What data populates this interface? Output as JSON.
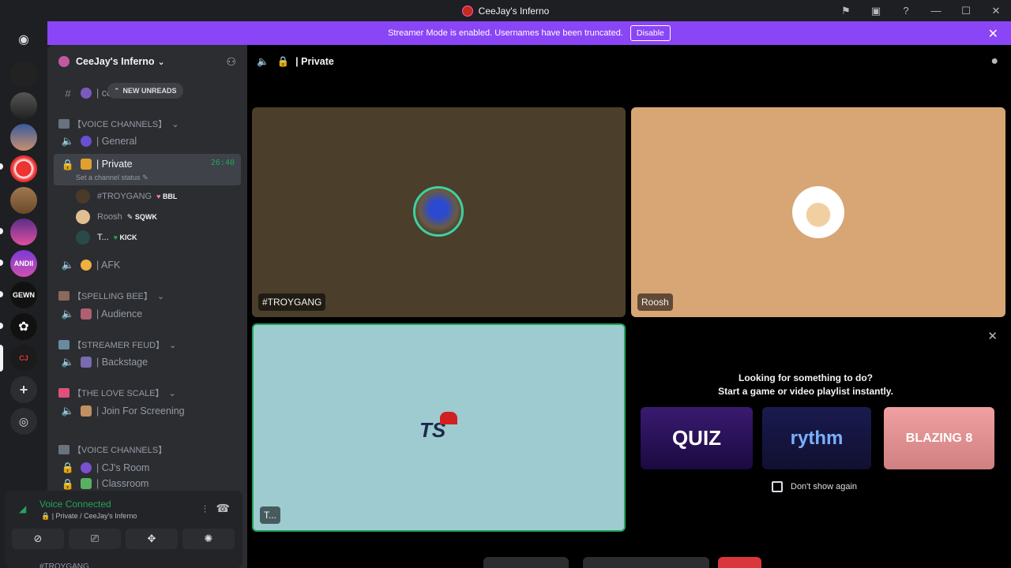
{
  "window": {
    "title": "CeeJay's Inferno",
    "minimize": "—",
    "maximize": "☐",
    "close": "✕"
  },
  "banner": {
    "text": "Streamer Mode is enabled. Usernames have been truncated.",
    "button": "Disable",
    "close": "✕"
  },
  "guild": {
    "name": "CeeJay's Inferno",
    "chevron": "⌄"
  },
  "unread_pill": "NEW UNREADS",
  "sidebar": {
    "top_channel": "| co",
    "cat_voice": "【VOICE CHANNELS】",
    "general": "| General",
    "private": "| Private",
    "private_timer": "26:40",
    "status_hint": "Set a channel status",
    "users": [
      {
        "name": "#TROYGANG",
        "badge": "BBL"
      },
      {
        "name": "Roosh",
        "badge": "SQWK"
      },
      {
        "name": "T...",
        "badge": "KICK"
      }
    ],
    "afk": "| AFK",
    "cat_spelling": "【SPELLING BEE】",
    "audience": "| Audience",
    "cat_feud": "【STREAMER FEUD】",
    "backstage": "| Backstage",
    "cat_love": "【THE LOVE SCALE】",
    "join_screening": "| Join For Screening",
    "cat_voice2": "【VOICE CHANNELS】",
    "cj_room": "| CJ's Room",
    "classroom": "| Classroom"
  },
  "voice_panel": {
    "title": "Voice Connected",
    "subtitle": "| Private / CeeJay's Inferno",
    "user_peek": "#TROYGANG"
  },
  "main": {
    "channel_title": "| Private",
    "tiles": [
      {
        "name": "#TROYGANG",
        "bg": "#4b3e2a"
      },
      {
        "name": "Roosh",
        "bg": "#d8a575"
      },
      {
        "name": "T...",
        "bg": "#9ecbd0"
      }
    ],
    "activity": {
      "line1": "Looking for something to do?",
      "line2": "Start a game or video playlist instantly.",
      "cards": [
        "QUIZ",
        "rythm",
        "BLAZING 8"
      ],
      "dont_show": "Don't show again",
      "close": "✕"
    }
  },
  "colors": {
    "accent": "#8a45f6",
    "green": "#23a55a"
  }
}
